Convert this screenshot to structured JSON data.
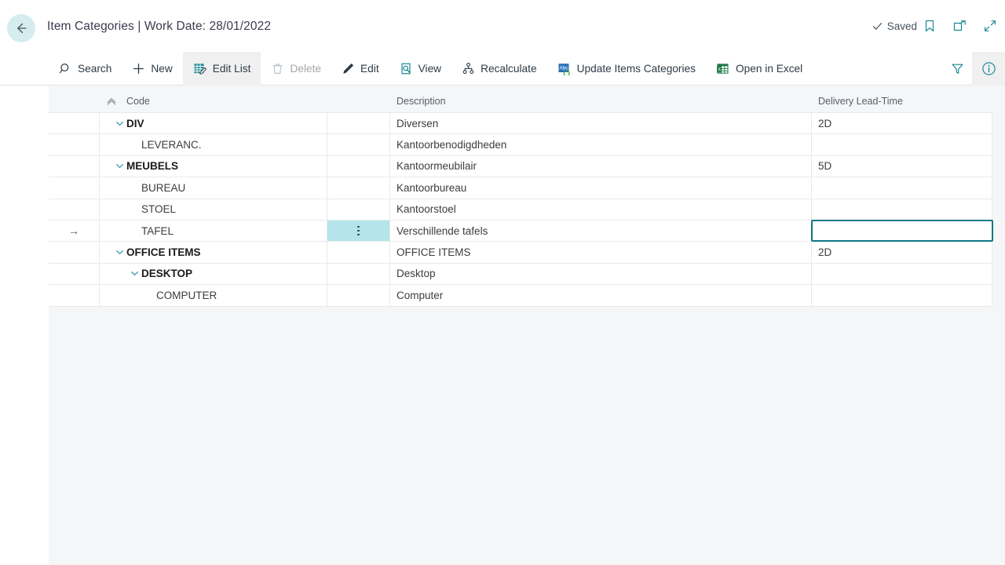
{
  "header": {
    "back_icon": "arrow-left-icon",
    "title": "Item Categories | Work Date: 28/01/2022",
    "saved_label": "Saved",
    "saved_icon": "check-icon",
    "icons": [
      {
        "name": "bookmark-icon"
      },
      {
        "name": "open-in-new-window-icon"
      },
      {
        "name": "collapse-icon"
      }
    ]
  },
  "toolbar": {
    "items": [
      {
        "label": "Search",
        "icon": "search-icon",
        "state": "normal"
      },
      {
        "label": "New",
        "icon": "plus-icon",
        "state": "normal"
      },
      {
        "label": "Edit List",
        "icon": "edit-list-icon",
        "state": "active"
      },
      {
        "label": "Delete",
        "icon": "trash-icon",
        "state": "disabled"
      },
      {
        "label": "Edit",
        "icon": "pencil-icon",
        "state": "normal"
      },
      {
        "label": "View",
        "icon": "view-page-icon",
        "state": "normal"
      },
      {
        "label": "Recalculate",
        "icon": "hierarchy-icon",
        "state": "normal"
      },
      {
        "label": "Update Items Categories",
        "icon": "update-abc-icon",
        "state": "normal"
      },
      {
        "label": "Open in Excel",
        "icon": "excel-icon",
        "state": "normal"
      }
    ],
    "right_icons": [
      {
        "name": "filter-icon",
        "shaded": false
      },
      {
        "name": "info-icon",
        "shaded": true
      }
    ]
  },
  "grid": {
    "columns": {
      "indicator": "",
      "code": "Code",
      "code_sort_icon": "chevron-up-sort-icon",
      "dots": "",
      "description": "Description",
      "lead_time": "Delivery Lead-Time"
    },
    "rows": [
      {
        "indicator": "",
        "level": 0,
        "expandable": true,
        "code": "DIV",
        "bold": true,
        "description": "Diversen",
        "lead_time": "2D",
        "selected_row": false,
        "dots_active": false
      },
      {
        "indicator": "",
        "level": 1,
        "expandable": false,
        "code": "LEVERANC.",
        "bold": false,
        "description": "Kantoorbenodigdheden",
        "lead_time": "",
        "selected_row": false,
        "dots_active": false
      },
      {
        "indicator": "",
        "level": 0,
        "expandable": true,
        "code": "MEUBELS",
        "bold": true,
        "description": "Kantoormeubilair",
        "lead_time": "5D",
        "selected_row": false,
        "dots_active": false
      },
      {
        "indicator": "",
        "level": 1,
        "expandable": false,
        "code": "BUREAU",
        "bold": false,
        "description": "Kantoorbureau",
        "lead_time": "",
        "selected_row": false,
        "dots_active": false
      },
      {
        "indicator": "",
        "level": 1,
        "expandable": false,
        "code": "STOEL",
        "bold": false,
        "description": "Kantoorstoel",
        "lead_time": "",
        "selected_row": false,
        "dots_active": false
      },
      {
        "indicator": "→",
        "level": 1,
        "expandable": false,
        "code": "TAFEL",
        "bold": false,
        "description": "Verschillende tafels",
        "lead_time": "",
        "selected_row": true,
        "dots_active": true
      },
      {
        "indicator": "",
        "level": 0,
        "expandable": true,
        "code": "OFFICE ITEMS",
        "bold": true,
        "description": "OFFICE ITEMS",
        "lead_time": "2D",
        "selected_row": false,
        "dots_active": false
      },
      {
        "indicator": "",
        "level": 1,
        "expandable": true,
        "code": "DESKTOP",
        "bold": true,
        "description": "Desktop",
        "lead_time": "",
        "selected_row": false,
        "dots_active": false
      },
      {
        "indicator": "",
        "level": 2,
        "expandable": false,
        "code": "COMPUTER",
        "bold": false,
        "description": "Computer",
        "lead_time": "",
        "selected_row": false,
        "dots_active": false
      }
    ],
    "selected_cell": {
      "row_index": 5,
      "column": "lead_time",
      "value": ""
    }
  },
  "colors": {
    "accent_teal": "#0f7a84",
    "icon_teal": "#1b8a95",
    "back_circle": "#d6edf0",
    "dots_highlight": "#b3e5ea",
    "content_bg": "#f5f6f7",
    "toolbar_active": "#f0f0f0"
  }
}
